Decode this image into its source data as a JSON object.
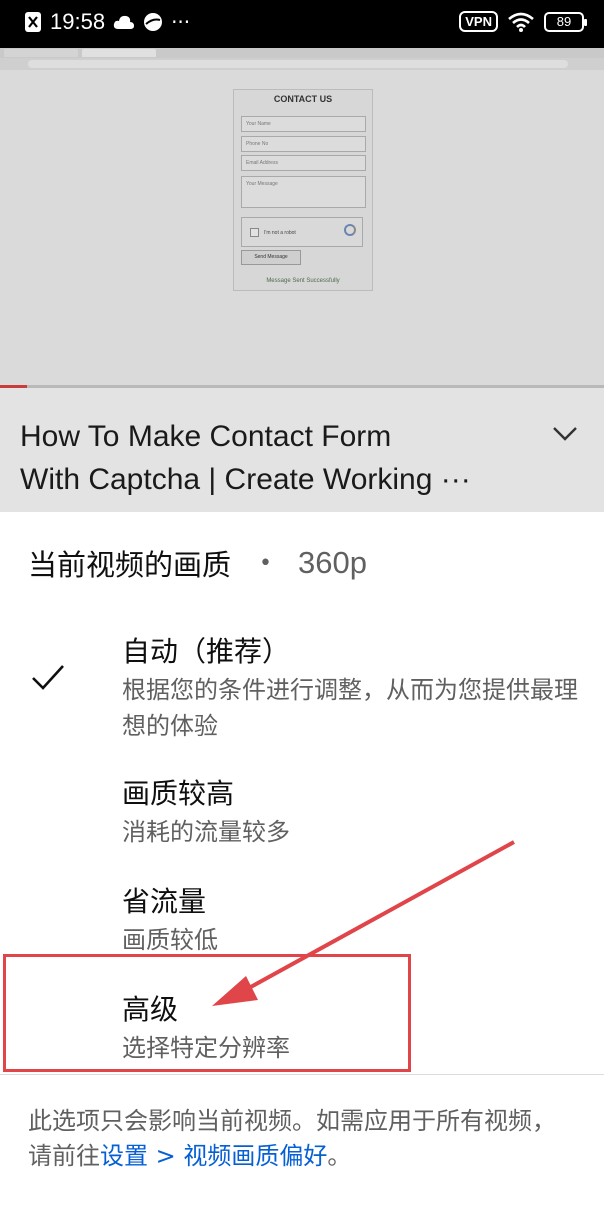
{
  "status_bar": {
    "time": "19:58",
    "more": "···",
    "vpn": "VPN",
    "battery": "89"
  },
  "player": {
    "form": {
      "title": "CONTACT US",
      "fields": [
        "Your Name",
        "Phone No",
        "Email Address",
        "Your Message"
      ],
      "captcha_label": "I'm not a robot",
      "send_button": "Send Message",
      "success_message": "Message Sent Successfully"
    },
    "progress": 0.045
  },
  "video": {
    "title_line1": "How To Make Contact Form",
    "title_line2": "With Captcha | Create Working ···"
  },
  "quality_sheet": {
    "header": "当前视频的画质",
    "separator": "•",
    "current_resolution": "360p",
    "options": [
      {
        "title": "自动（推荐）",
        "subtitle": "根据您的条件进行调整，从而为您提供最理想的体验",
        "selected": true
      },
      {
        "title": "画质较高",
        "subtitle": "消耗的流量较多",
        "selected": false
      },
      {
        "title": "省流量",
        "subtitle": "画质较低",
        "selected": false
      },
      {
        "title": "高级",
        "subtitle": "选择特定分辨率",
        "selected": false
      }
    ],
    "footnote_text": "此选项只会影响当前视频。如需应用于所有视频，请前往",
    "footnote_link": "设置 > 视频画质偏好",
    "footnote_end": "。"
  },
  "colors": {
    "annotation": "#e0454a",
    "link": "#065fd4",
    "progress": "#c83c3c"
  }
}
